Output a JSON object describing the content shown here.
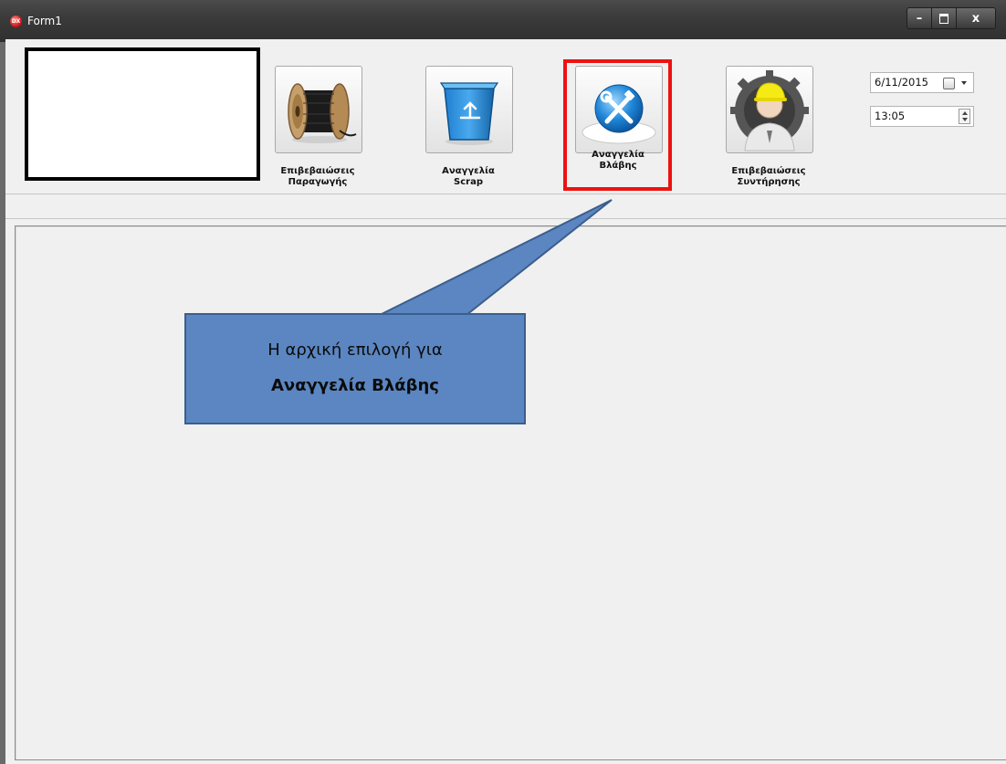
{
  "window": {
    "title": "Form1"
  },
  "toolbar": {
    "buttons": [
      {
        "line1": "Επιβεβαιώσεις",
        "line2": "Παραγωγής",
        "icon": "cable-reel-icon"
      },
      {
        "line1": "Αναγγελία",
        "line2": "Scrap",
        "icon": "recycle-bin-icon"
      },
      {
        "line1": "Αναγγελία",
        "line2": "Βλάβης",
        "icon": "tools-icon"
      },
      {
        "line1": "Επιβεβαιώσεις",
        "line2": "Συντήρησης",
        "icon": "maintenance-worker-icon"
      }
    ]
  },
  "date_picker": {
    "value": "6/11/2015"
  },
  "time_picker": {
    "value": "13:05"
  },
  "callout": {
    "line1": "Η αρχική επιλογή για",
    "line2": "Αναγγελία Βλάβης"
  },
  "colors": {
    "highlight": "#ee1111",
    "callout_fill": "#5b86c1",
    "callout_border": "#3b5e8c"
  }
}
